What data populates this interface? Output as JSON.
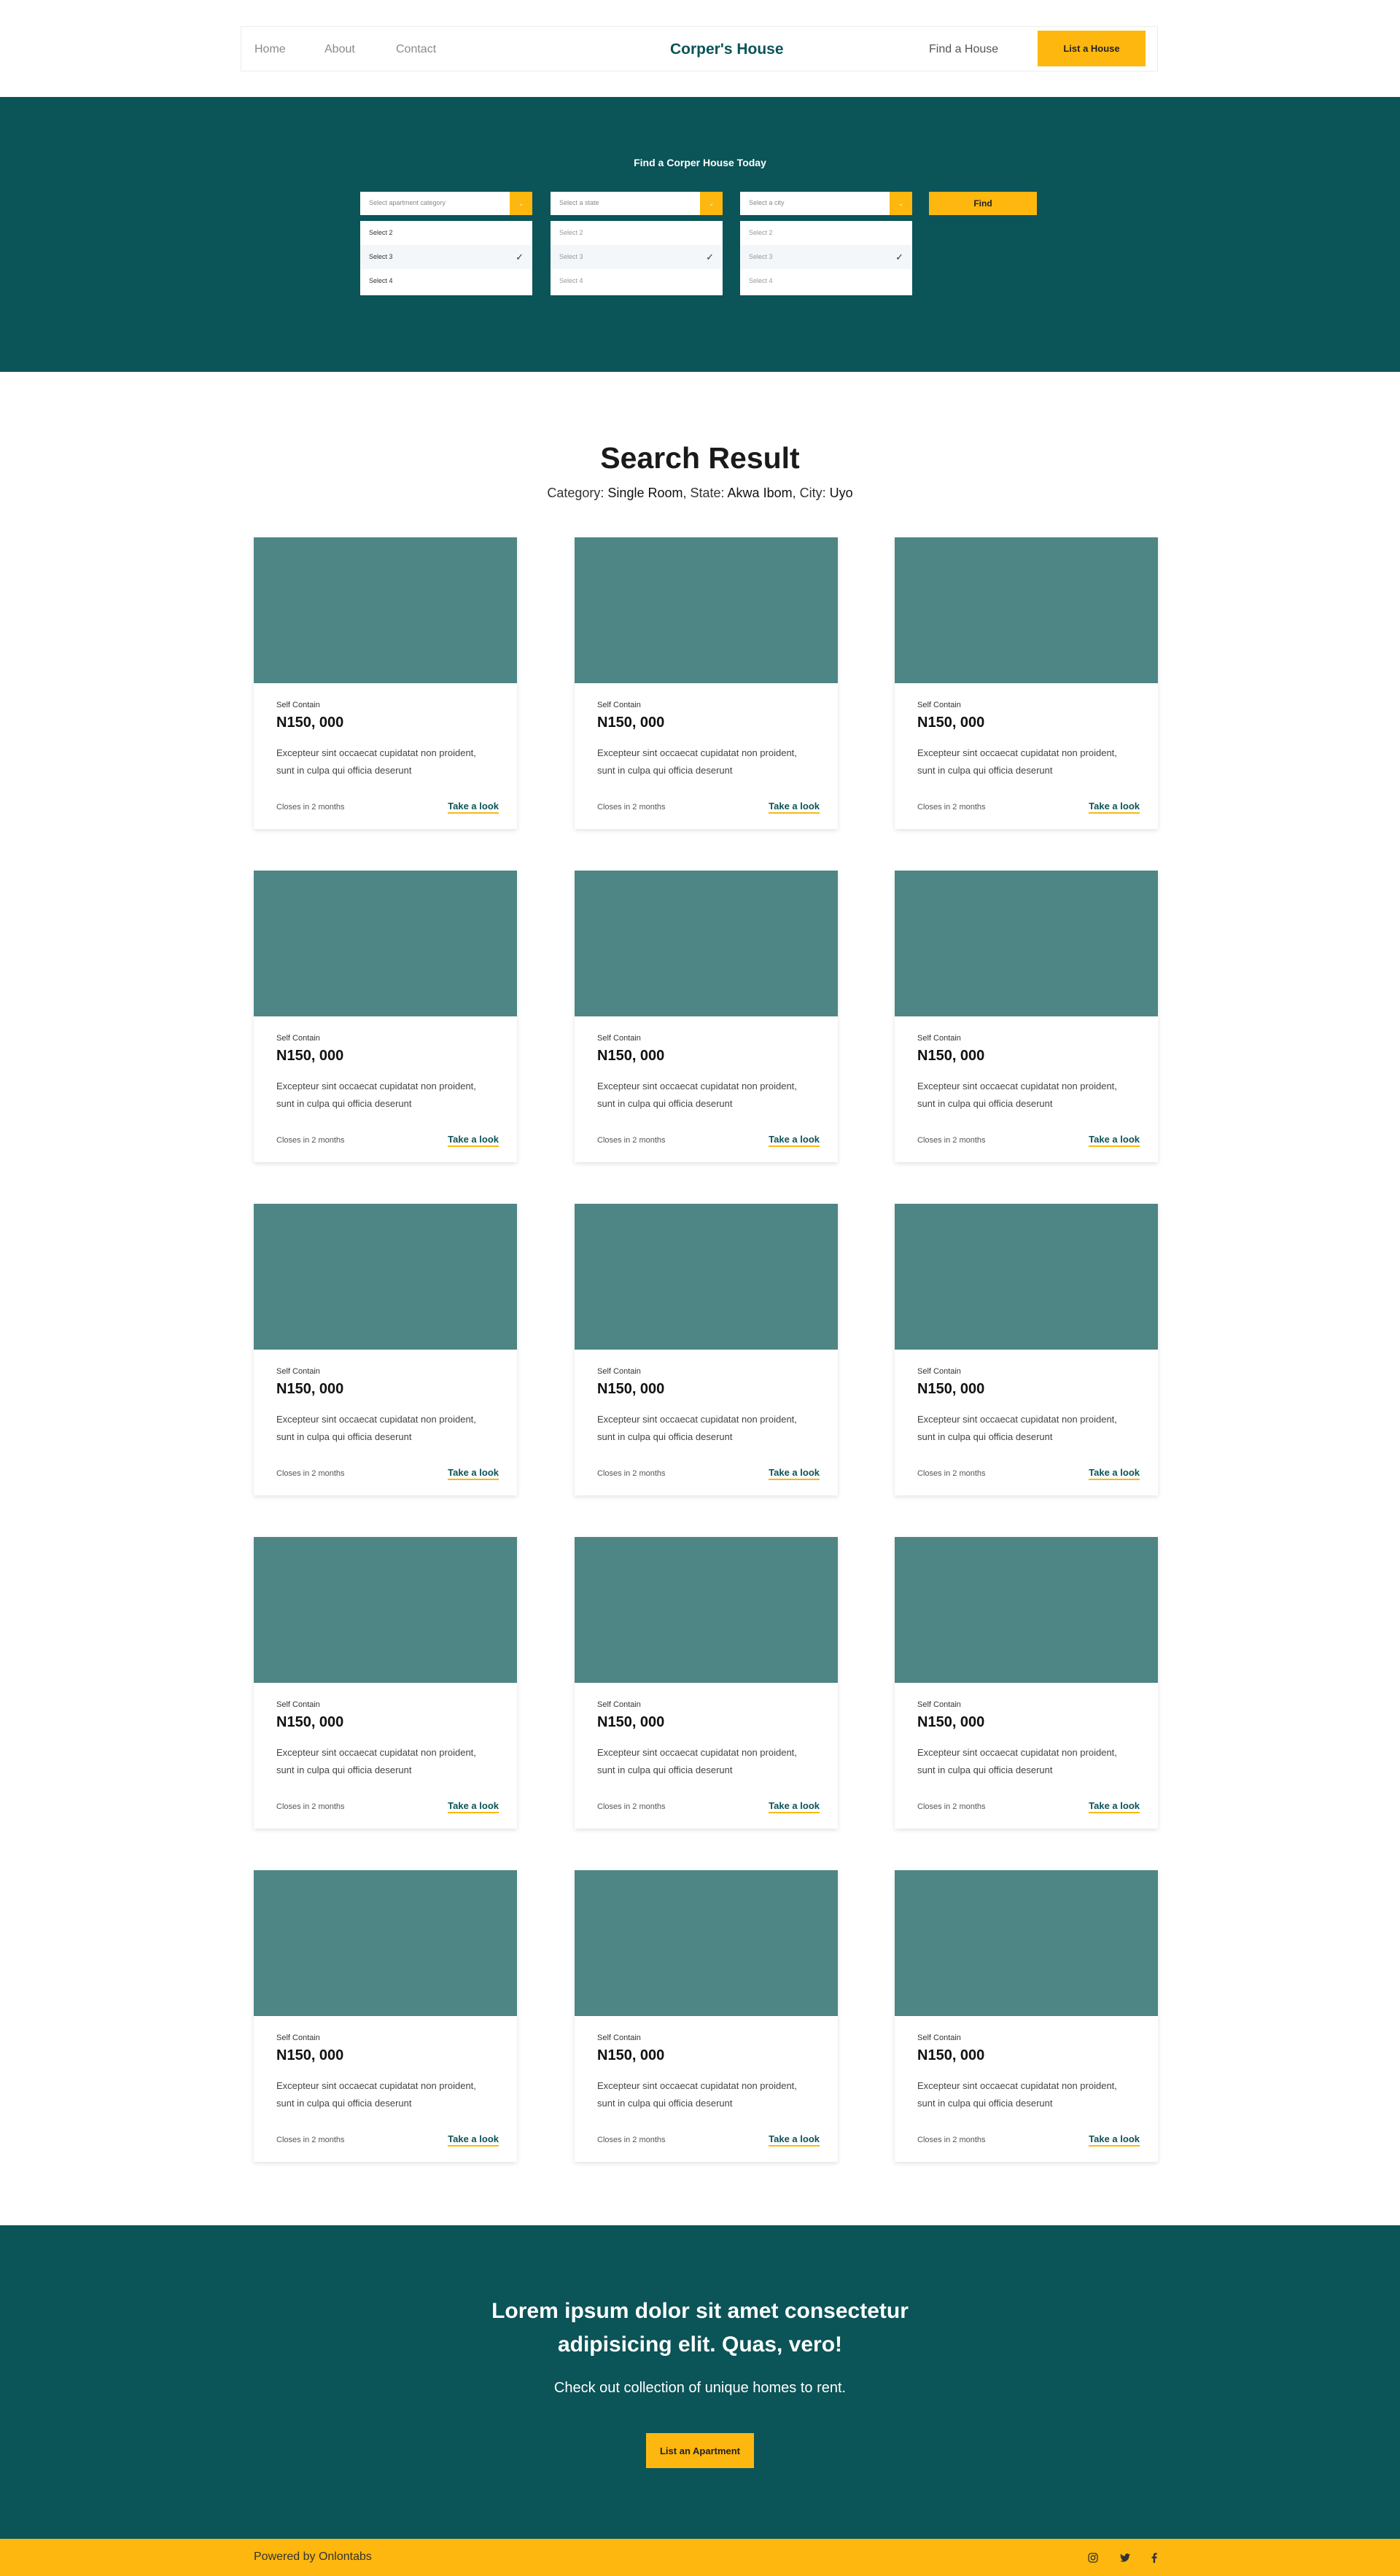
{
  "nav": {
    "home": "Home",
    "about": "About",
    "contact": "Contact",
    "brand": "Corper's House",
    "find": "Find a House",
    "list_button": "List a House"
  },
  "hero": {
    "title": "Find a Corper House Today",
    "selects": [
      {
        "placeholder": "Select apartment category",
        "options": [
          "Select 2",
          "Select 3",
          "Select 4"
        ],
        "selected_index": 1
      },
      {
        "placeholder": "Select a state",
        "options": [
          "Select 2",
          "Select 3",
          "Select 4"
        ],
        "selected_index": 1
      },
      {
        "placeholder": "Select a city",
        "options": [
          "Select 2",
          "Select 3",
          "Select 4"
        ],
        "selected_index": 1
      }
    ],
    "find_button": "Find",
    "caret": "⌄"
  },
  "results": {
    "title": "Search Result",
    "category_label": "Category:",
    "category_value": "Single Room",
    "state_label": "State:",
    "state_value": "Akwa Ibom",
    "city_label": "City:",
    "city_value": "Uyo",
    "cards": [
      {
        "category": "Self Contain",
        "price": "N150, 000",
        "description": "Excepteur sint occaecat cupidatat non proident, sunt in culpa qui officia deserunt",
        "closes": "Closes in 2 months",
        "link": "Take a look"
      },
      {
        "category": "Self Contain",
        "price": "N150, 000",
        "description": "Excepteur sint occaecat cupidatat non proident, sunt in culpa qui officia deserunt",
        "closes": "Closes in 2 months",
        "link": "Take a look"
      },
      {
        "category": "Self Contain",
        "price": "N150, 000",
        "description": "Excepteur sint occaecat cupidatat non proident, sunt in culpa qui officia deserunt",
        "closes": "Closes in 2 months",
        "link": "Take a look"
      },
      {
        "category": "Self Contain",
        "price": "N150, 000",
        "description": "Excepteur sint occaecat cupidatat non proident, sunt in culpa qui officia deserunt",
        "closes": "Closes in 2 months",
        "link": "Take a look"
      },
      {
        "category": "Self Contain",
        "price": "N150, 000",
        "description": "Excepteur sint occaecat cupidatat non proident, sunt in culpa qui officia deserunt",
        "closes": "Closes in 2 months",
        "link": "Take a look"
      },
      {
        "category": "Self Contain",
        "price": "N150, 000",
        "description": "Excepteur sint occaecat cupidatat non proident, sunt in culpa qui officia deserunt",
        "closes": "Closes in 2 months",
        "link": "Take a look"
      },
      {
        "category": "Self Contain",
        "price": "N150, 000",
        "description": "Excepteur sint occaecat cupidatat non proident, sunt in culpa qui officia deserunt",
        "closes": "Closes in 2 months",
        "link": "Take a look"
      },
      {
        "category": "Self Contain",
        "price": "N150, 000",
        "description": "Excepteur sint occaecat cupidatat non proident, sunt in culpa qui officia deserunt",
        "closes": "Closes in 2 months",
        "link": "Take a look"
      },
      {
        "category": "Self Contain",
        "price": "N150, 000",
        "description": "Excepteur sint occaecat cupidatat non proident, sunt in culpa qui officia deserunt",
        "closes": "Closes in 2 months",
        "link": "Take a look"
      },
      {
        "category": "Self Contain",
        "price": "N150, 000",
        "description": "Excepteur sint occaecat cupidatat non proident, sunt in culpa qui officia deserunt",
        "closes": "Closes in 2 months",
        "link": "Take a look"
      },
      {
        "category": "Self Contain",
        "price": "N150, 000",
        "description": "Excepteur sint occaecat cupidatat non proident, sunt in culpa qui officia deserunt",
        "closes": "Closes in 2 months",
        "link": "Take a look"
      },
      {
        "category": "Self Contain",
        "price": "N150, 000",
        "description": "Excepteur sint occaecat cupidatat non proident, sunt in culpa qui officia deserunt",
        "closes": "Closes in 2 months",
        "link": "Take a look"
      },
      {
        "category": "Self Contain",
        "price": "N150, 000",
        "description": "Excepteur sint occaecat cupidatat non proident, sunt in culpa qui officia deserunt",
        "closes": "Closes in 2 months",
        "link": "Take a look"
      },
      {
        "category": "Self Contain",
        "price": "N150, 000",
        "description": "Excepteur sint occaecat cupidatat non proident, sunt in culpa qui officia deserunt",
        "closes": "Closes in 2 months",
        "link": "Take a look"
      },
      {
        "category": "Self Contain",
        "price": "N150, 000",
        "description": "Excepteur sint occaecat cupidatat non proident, sunt in culpa qui officia deserunt",
        "closes": "Closes in 2 months",
        "link": "Take a look"
      }
    ]
  },
  "cta": {
    "heading": "Lorem ipsum dolor sit amet consectetur adipisicing elit. Quas, vero!",
    "subtitle": "Check out collection of unique homes to rent.",
    "button": "List an Apartment"
  },
  "footer": {
    "text": "Powered by Onlontabs",
    "social_icons": [
      "instagram-icon",
      "twitter-icon",
      "facebook-icon"
    ]
  },
  "colors": {
    "primary": "#0b5458",
    "accent": "#fdb70e",
    "card_image": "#4e8585"
  }
}
